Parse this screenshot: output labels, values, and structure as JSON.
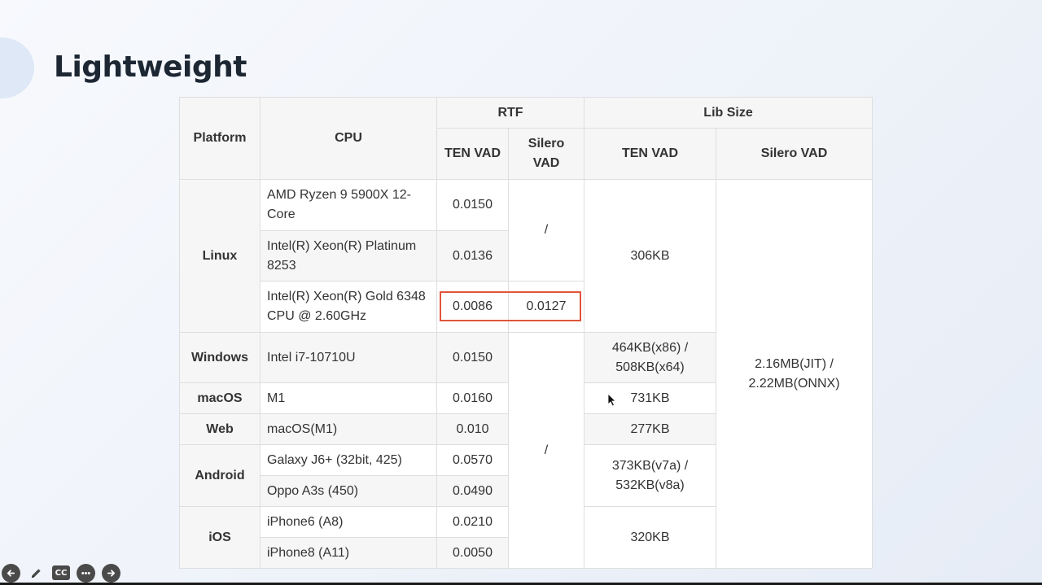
{
  "slide": {
    "title": "Lightweight"
  },
  "table": {
    "headers": {
      "platform": "Platform",
      "cpu": "CPU",
      "rtf": "RTF",
      "lib_size": "Lib Size",
      "rtf_ten": "TEN VAD",
      "rtf_silero": "Silero VAD",
      "lib_ten": "TEN VAD",
      "lib_silero": "Silero VAD"
    },
    "rows": [
      {
        "platform": "Linux",
        "cpu": "AMD Ryzen 9 5900X 12-Core",
        "rtf_ten": "0.0150"
      },
      {
        "cpu": "Intel(R) Xeon(R) Platinum 8253",
        "rtf_ten": "0.0136"
      },
      {
        "cpu": "Intel(R) Xeon(R) Gold 6348 CPU @ 2.60GHz",
        "rtf_ten": "0.0086",
        "rtf_silero": "0.0127"
      },
      {
        "platform": "Windows",
        "cpu": "Intel i7-10710U",
        "rtf_ten": "0.0150"
      },
      {
        "platform": "macOS",
        "cpu": "M1",
        "rtf_ten": "0.0160"
      },
      {
        "platform": "Web",
        "cpu": "macOS(M1)",
        "rtf_ten": "0.010"
      },
      {
        "platform": "Android",
        "cpu": "Galaxy J6+ (32bit, 425)",
        "rtf_ten": "0.0570"
      },
      {
        "cpu": "Oppo A3s (450)",
        "rtf_ten": "0.0490"
      },
      {
        "platform": "iOS",
        "cpu": "iPhone6 (A8)",
        "rtf_ten": "0.0210"
      },
      {
        "cpu": "iPhone8 (A11)",
        "rtf_ten": "0.0050"
      }
    ],
    "merged": {
      "linux_silero_rtf": "/",
      "other_silero_rtf": "/",
      "linux_ten_lib": "306KB",
      "windows_ten_lib": "464KB(x86) / 508KB(x64)",
      "macos_ten_lib": "731KB",
      "web_ten_lib": "277KB",
      "android_ten_lib": "373KB(v7a) / 532KB(v8a)",
      "ios_ten_lib": "320KB",
      "silero_lib": "2.16MB(JIT) / 2.22MB(ONNX)"
    },
    "highlight_color": "#e0553a"
  },
  "toolbar": {
    "icons": [
      "arrow-left-icon",
      "pencil-icon",
      "closed-caption-icon",
      "more-icon",
      "arrow-right-icon"
    ],
    "cc_label": "CC"
  }
}
